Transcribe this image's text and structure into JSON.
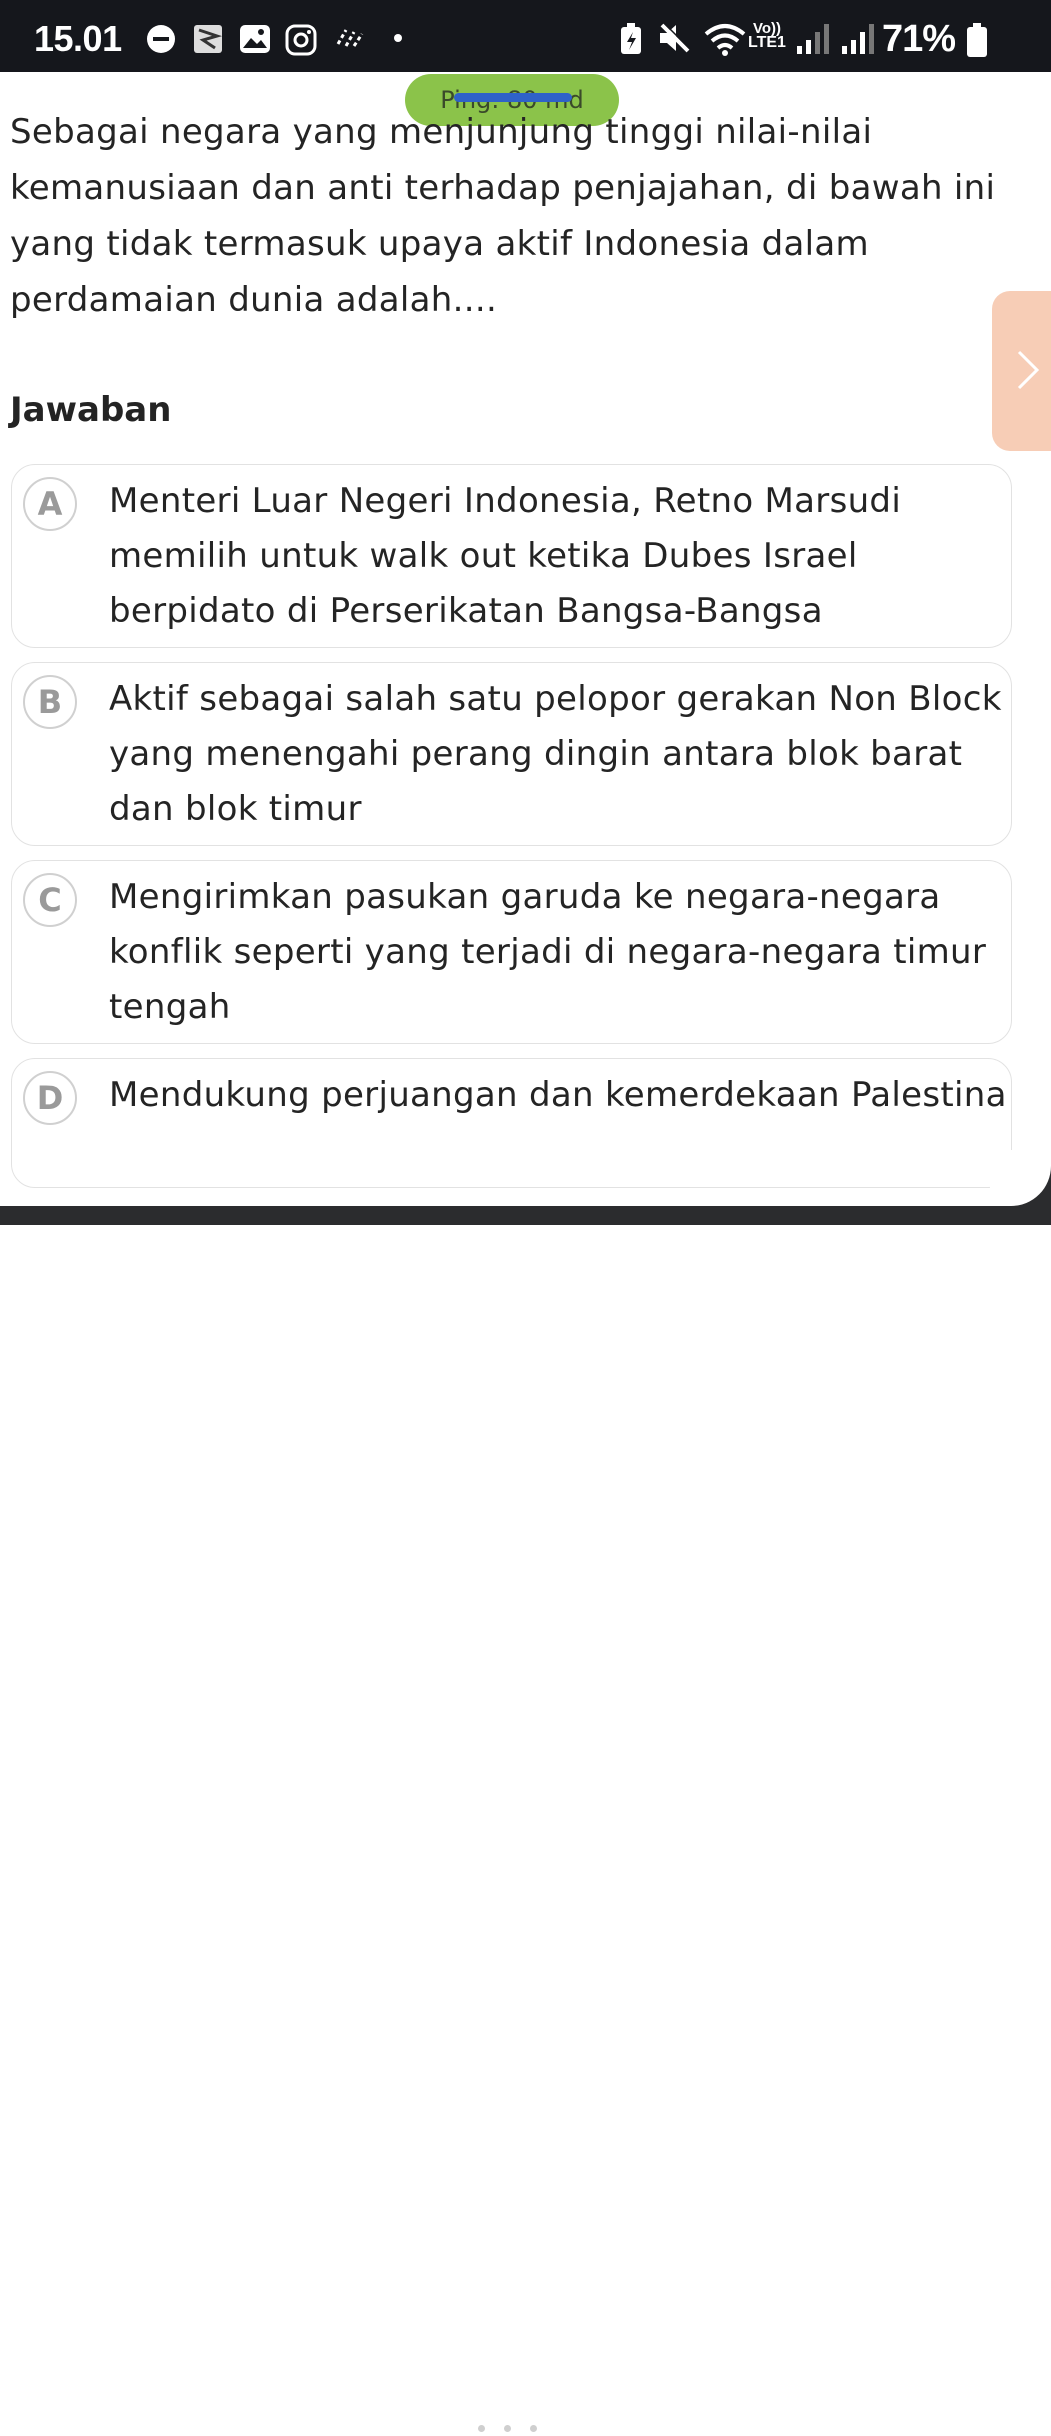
{
  "status_bar": {
    "time": "15.01",
    "network_top": "Vo))",
    "network_bottom": "LTE1",
    "battery_percent": "71%",
    "icons": [
      "minus-circle-icon",
      "app-thumbnail-icon",
      "gallery-icon",
      "instagram-icon",
      "sparkle-icon",
      "dot-icon",
      "battery-saver-icon",
      "mute-icon",
      "wifi-icon",
      "signal-icon",
      "signal-icon",
      "battery-icon"
    ]
  },
  "ping": {
    "label": "Ping: 80 md"
  },
  "question": {
    "text": "Sebagai negara yang menjunjung tinggi nilai-nilai kemanusiaan dan anti terhadap penjajahan, di bawah ini yang tidak termasuk upaya aktif Indonesia dalam perdamaian dunia adalah...."
  },
  "side_tab": {
    "icon": "chevron-right-icon"
  },
  "answers": {
    "heading": "Jawaban",
    "options": [
      {
        "letter": "A",
        "text": "Menteri Luar Negeri Indonesia, Retno Marsudi memilih untuk walk out ketika Dubes Israel berpidato di Perserikatan Bangsa-Bangsa"
      },
      {
        "letter": "B",
        "text": "Aktif sebagai salah satu pelopor gerakan Non Block yang menengahi perang dingin antara blok barat dan blok timur"
      },
      {
        "letter": "C",
        "text": "Mengirimkan pasukan garuda ke negara-negara konflik seperti yang terjadi di negara-negara timur tengah"
      },
      {
        "letter": "D",
        "text": "Mendukung perjuangan dan kemerdekaan Palestina"
      }
    ]
  },
  "colors": {
    "status_bar_bg": "#15171c",
    "ping_pill": "#8bc34a",
    "side_tab": "#f7cdb6",
    "option_border": "#e2e2e2"
  }
}
